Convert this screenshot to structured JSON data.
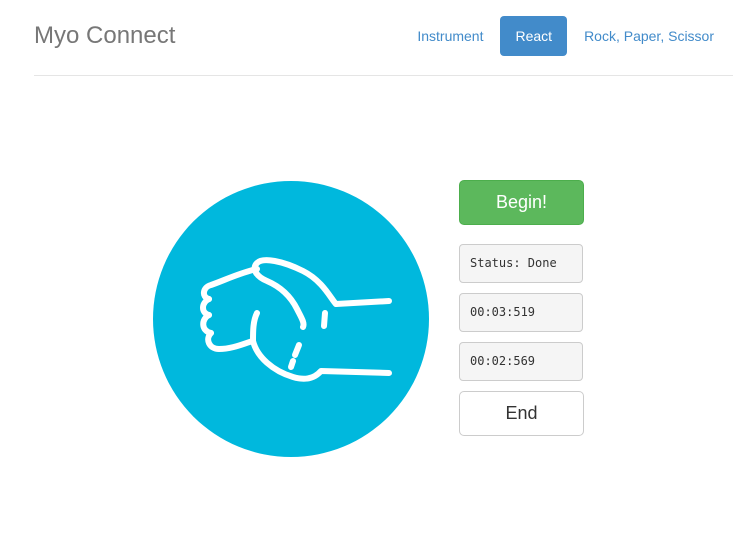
{
  "header": {
    "brand": "Myo Connect",
    "nav": [
      {
        "label": "Instrument",
        "active": false
      },
      {
        "label": "React",
        "active": true
      },
      {
        "label": "Rock, Paper, Scissor",
        "active": false
      }
    ]
  },
  "gesture": {
    "icon": "open-palm-hand-icon",
    "circle_color": "#00b8dd"
  },
  "controls": {
    "begin_label": "Begin!",
    "status": "Status: Done",
    "time_1": "00:03:519",
    "time_2": "00:02:569",
    "end_label": "End"
  },
  "colors": {
    "accent": "#428bca",
    "success": "#5cb85c"
  }
}
